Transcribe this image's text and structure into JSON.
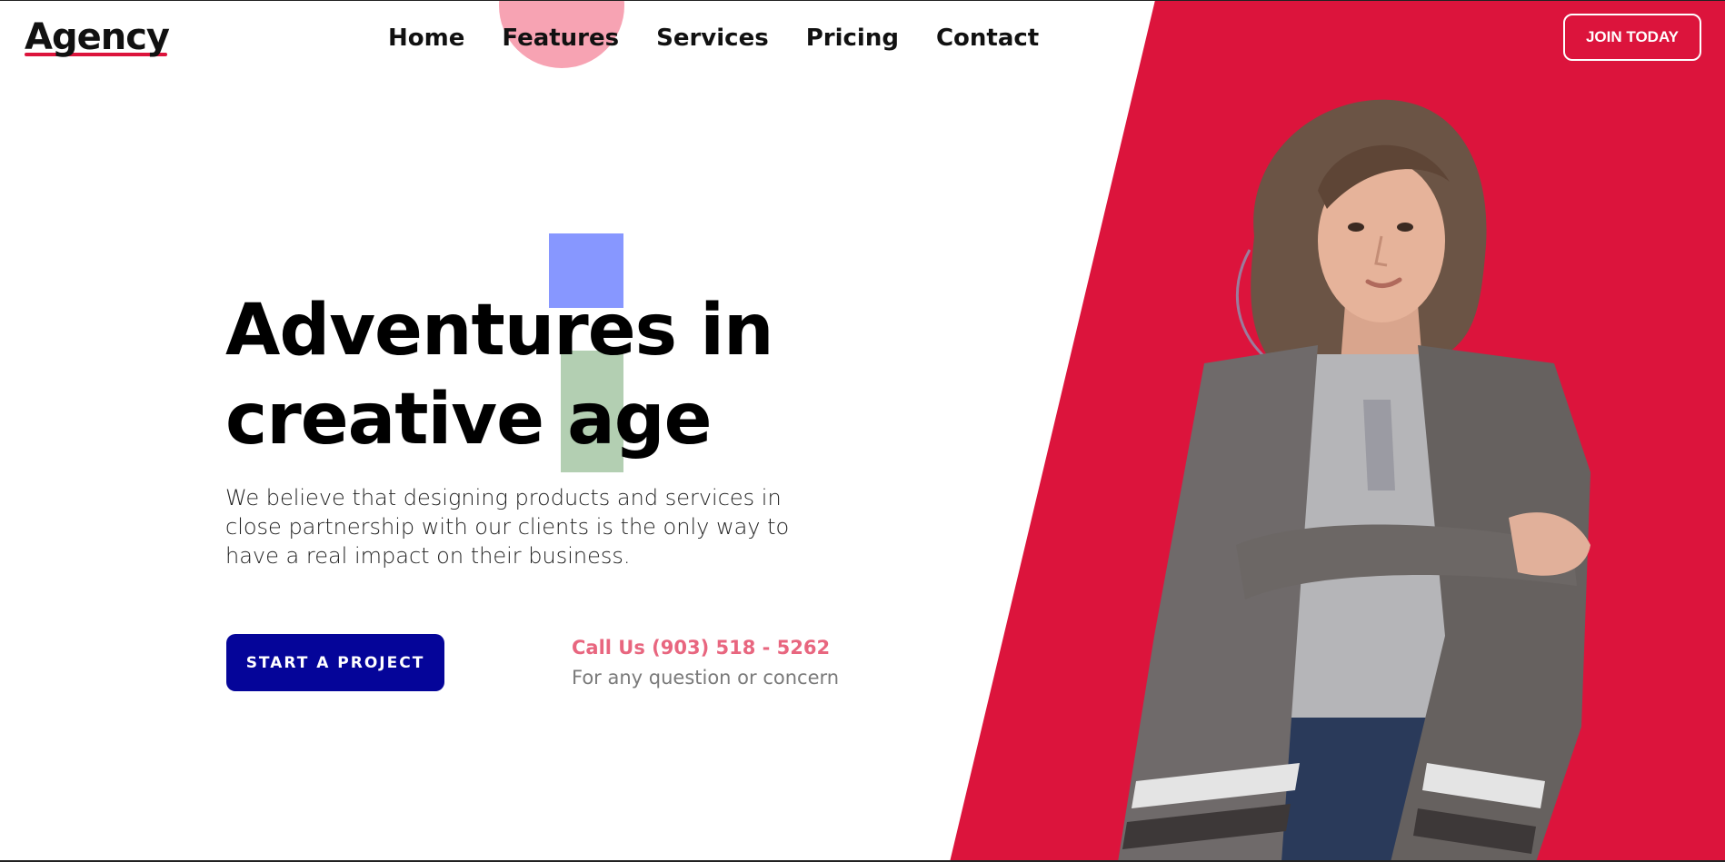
{
  "header": {
    "logo": "Agency",
    "nav": [
      "Home",
      "Features",
      "Services",
      "Pricing",
      "Contact"
    ],
    "cta": "JOIN TODAY"
  },
  "hero": {
    "title_line1": "Adventures in",
    "title_line2": "creative age",
    "description": "We believe that designing products and services in close partnership with our clients is the only way to have a real impact on their business.",
    "cta": "START A PROJECT",
    "call_label": "Call Us (903) 518 - 5262",
    "call_sub": "For any question or concern",
    "image": "woman-in-gray-poncho-photo"
  },
  "colors": {
    "accent_red": "#dc143c",
    "cta_blue": "#050599",
    "call_pink": "#e8667f",
    "deco_circle": "#f7a3b3",
    "deco_blue": "#8797ff",
    "deco_green": "#b3cfb2"
  }
}
